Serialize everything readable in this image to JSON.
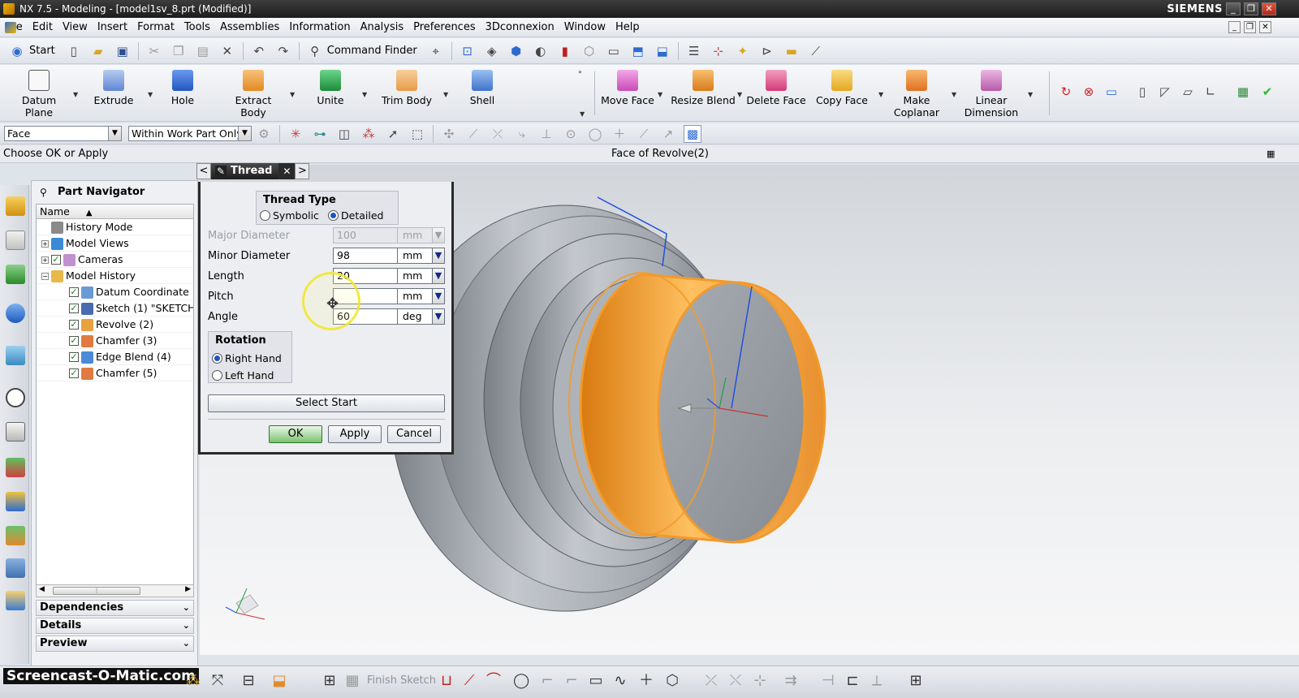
{
  "window": {
    "title": "NX 7.5 - Modeling - [model1sv_8.prt (Modified)]",
    "brand": "SIEMENS",
    "minimize": "_",
    "restore": "❐",
    "close": "✕"
  },
  "menu": [
    "File",
    "Edit",
    "View",
    "Insert",
    "Format",
    "Tools",
    "Assemblies",
    "Information",
    "Analysis",
    "Preferences",
    "3Dconnexion",
    "Window",
    "Help"
  ],
  "standard_toolbar": {
    "start_label": "Start",
    "command_finder_label": "Command Finder"
  },
  "feature_toolbar": [
    {
      "label": "Datum Plane",
      "color": "#f4f4f4"
    },
    {
      "label": "Extrude",
      "color": "#7fa6e6"
    },
    {
      "label": "Hole",
      "color": "#3b72d8"
    },
    {
      "label": "Extract Body",
      "color": "#f0a23a"
    },
    {
      "label": "Unite",
      "color": "#2aa84a"
    },
    {
      "label": "Trim Body",
      "color": "#f0b26a"
    },
    {
      "label": "Shell",
      "color": "#5b8fdc"
    },
    {
      "label": "Move Face",
      "color": "#e06ad0"
    },
    {
      "label": "Resize Blend",
      "color": "#f0a030"
    },
    {
      "label": "Delete Face",
      "color": "#e34d8c"
    },
    {
      "label": "Copy Face",
      "color": "#f4c040"
    },
    {
      "label": "Make Coplanar",
      "color": "#f09030"
    },
    {
      "label": "Linear Dimension",
      "color": "#d07ac8"
    }
  ],
  "selection_bar": {
    "filter": "Face",
    "scope": "Within Work Part Only"
  },
  "cue_line": {
    "prompt": "Choose OK or Apply",
    "status": "Face of Revolve(2)"
  },
  "part_navigator": {
    "title": "Part Navigator",
    "column_name": "Name",
    "sort_indicator": "▲",
    "items": [
      {
        "label": "History Mode",
        "level": 0,
        "expander": "",
        "checked": false,
        "icon_color": "#8a8a8a"
      },
      {
        "label": "Model Views",
        "level": 0,
        "expander": "+",
        "checked": false,
        "icon_color": "#3a8ad6"
      },
      {
        "label": "Cameras",
        "level": 0,
        "expander": "+",
        "checked": true,
        "icon_color": "#c090d0"
      },
      {
        "label": "Model History",
        "level": 0,
        "expander": "−",
        "checked": false,
        "icon_color": "#e8b84a"
      },
      {
        "label": "Datum Coordinate ...",
        "level": 1,
        "expander": "",
        "checked": true,
        "icon_color": "#6a9ad6"
      },
      {
        "label": "Sketch (1) \"SKETCH...",
        "level": 1,
        "expander": "",
        "checked": true,
        "icon_color": "#4a6ab0"
      },
      {
        "label": "Revolve (2)",
        "level": 1,
        "expander": "",
        "checked": true,
        "icon_color": "#e8a040"
      },
      {
        "label": "Chamfer (3)",
        "level": 1,
        "expander": "",
        "checked": true,
        "icon_color": "#e07a40"
      },
      {
        "label": "Edge Blend (4)",
        "level": 1,
        "expander": "",
        "checked": true,
        "icon_color": "#4a8ad6"
      },
      {
        "label": "Chamfer (5)",
        "level": 1,
        "expander": "",
        "checked": true,
        "icon_color": "#e07a40"
      }
    ],
    "sections": [
      "Dependencies",
      "Details",
      "Preview"
    ]
  },
  "dialog": {
    "title": "Thread",
    "prev": "<",
    "next": ">",
    "close": "✕",
    "thread_type": {
      "title": "Thread Type",
      "options": [
        "Symbolic",
        "Detailed"
      ],
      "selected": "Detailed"
    },
    "fields": [
      {
        "label": "Major Diameter",
        "value": "100",
        "unit": "mm",
        "disabled": true
      },
      {
        "label": "Minor Diameter",
        "value": "98",
        "unit": "mm",
        "disabled": false
      },
      {
        "label": "Length",
        "value": "20",
        "unit": "mm",
        "disabled": false
      },
      {
        "label": "Pitch",
        "value": "",
        "unit": "mm",
        "disabled": false
      },
      {
        "label": "Angle",
        "value": "60",
        "unit": "deg",
        "disabled": false
      }
    ],
    "rotation": {
      "title": "Rotation",
      "options": [
        "Right Hand",
        "Left Hand"
      ],
      "selected": "Right Hand"
    },
    "select_start_label": "Select Start",
    "ok_label": "OK",
    "apply_label": "Apply",
    "cancel_label": "Cancel"
  },
  "bottom_toolbar": {
    "finish_sketch_label": "Finish Sketch"
  },
  "watermark": "Screencast-O-Matic.com",
  "colors": {
    "part_body": "#b7bcc2",
    "selected_face": "#f5a030",
    "face_end": "#9aa0a6"
  }
}
